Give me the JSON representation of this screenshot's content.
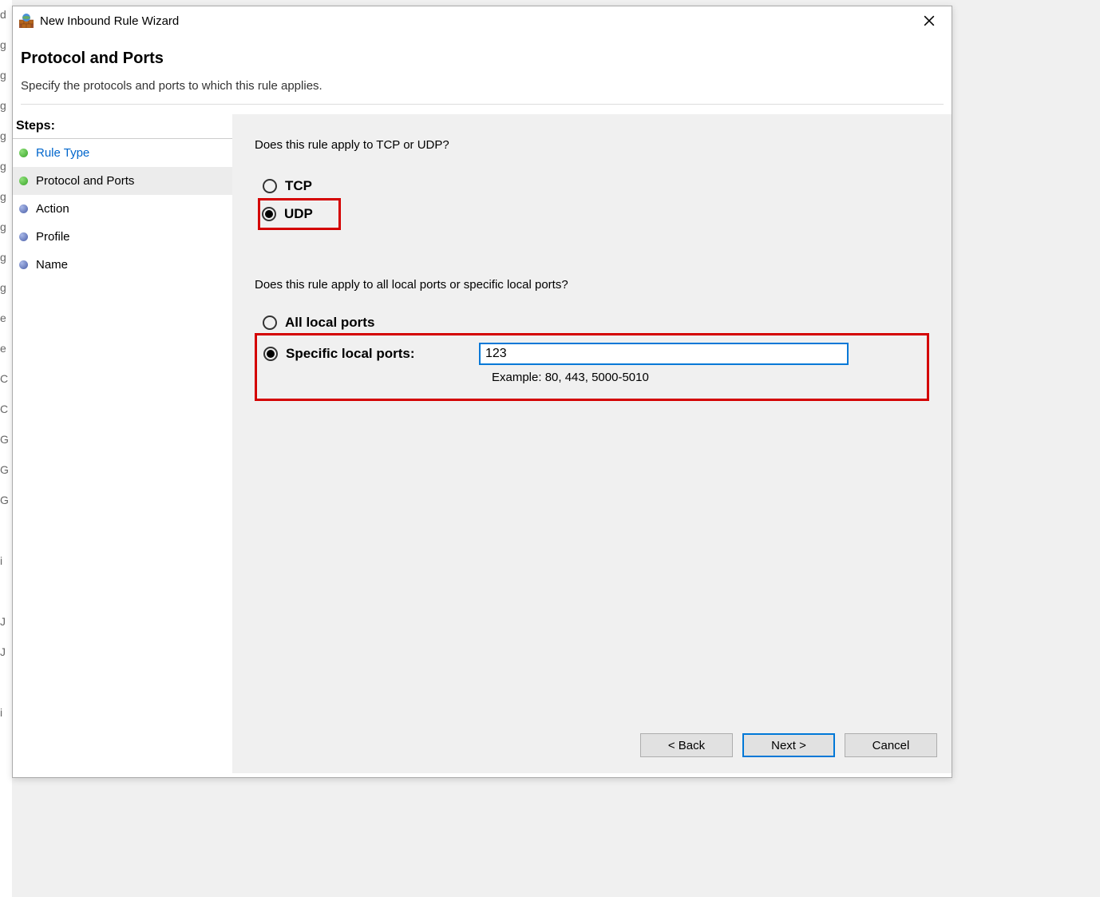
{
  "window": {
    "title": "New Inbound Rule Wizard"
  },
  "header": {
    "title": "Protocol and Ports",
    "subtitle": "Specify the protocols and ports to which this rule applies."
  },
  "sidebar": {
    "title": "Steps:",
    "items": [
      {
        "label": "Rule Type",
        "bullet": "green",
        "link": true
      },
      {
        "label": "Protocol and Ports",
        "bullet": "green",
        "active": true
      },
      {
        "label": "Action",
        "bullet": "blue"
      },
      {
        "label": "Profile",
        "bullet": "blue"
      },
      {
        "label": "Name",
        "bullet": "blue"
      }
    ]
  },
  "main": {
    "protocol_question": "Does this rule apply to TCP or UDP?",
    "tcp_label": "TCP",
    "udp_label": "UDP",
    "port_question": "Does this rule apply to all local ports or specific local ports?",
    "all_ports_label": "All local ports",
    "specific_ports_label": "Specific local ports:",
    "port_value": "123",
    "example_text": "Example: 80, 443, 5000-5010"
  },
  "footer": {
    "back_label": "< Back",
    "next_label": "Next >",
    "cancel_label": "Cancel"
  },
  "gutter": [
    "d",
    "g",
    "g",
    "g",
    "g",
    "g",
    "g",
    "g",
    "g",
    "g",
    "e",
    "e",
    "",
    "G",
    "G",
    "G",
    "",
    "i",
    "J",
    "J",
    "",
    "i"
  ]
}
